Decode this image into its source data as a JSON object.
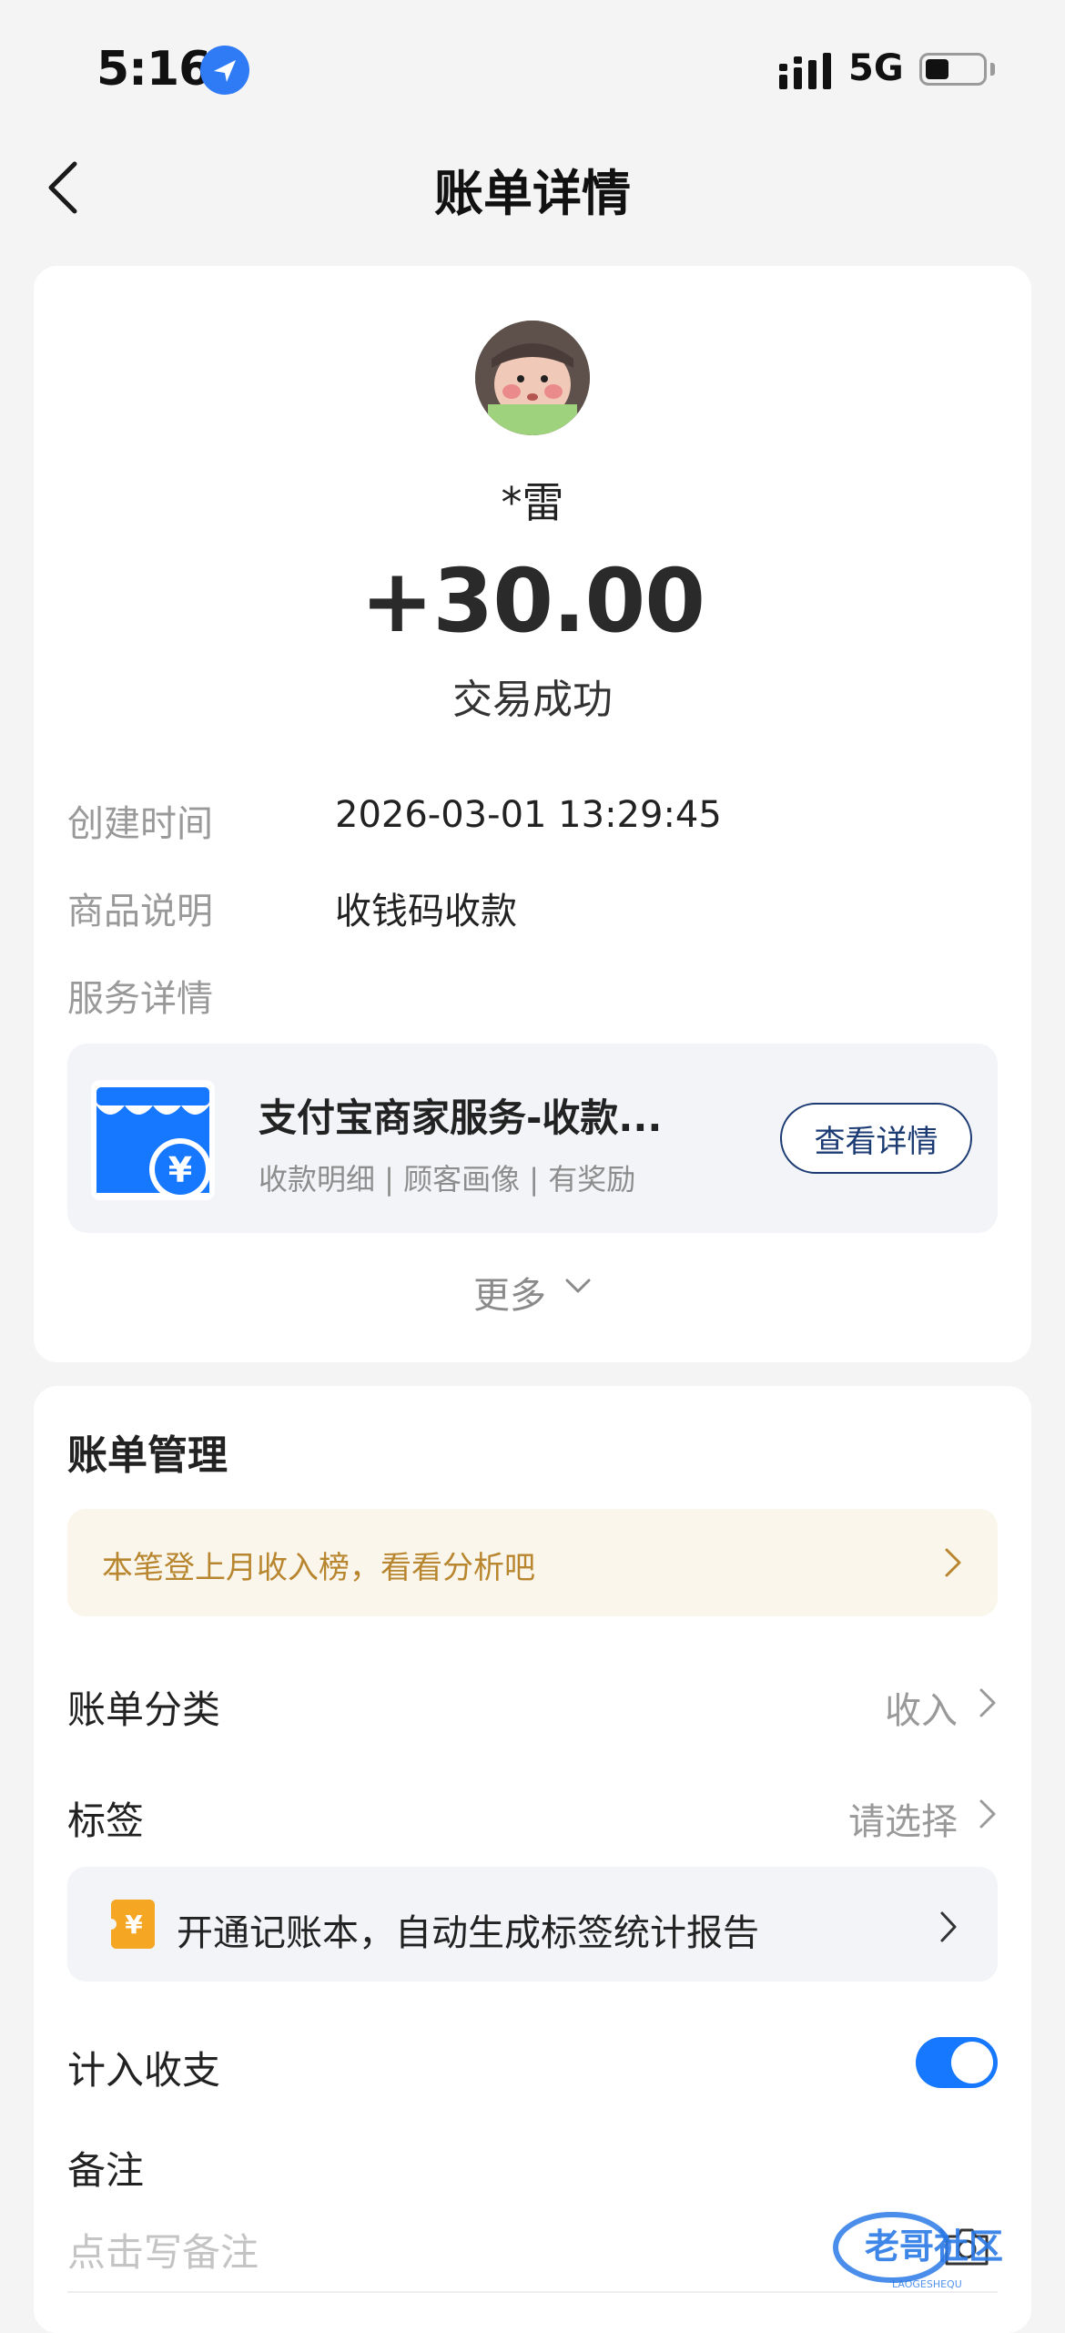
{
  "status_bar": {
    "time": "5:16",
    "network": "5G",
    "battery_level": 0.4
  },
  "nav": {
    "title": "账单详情"
  },
  "transaction": {
    "name": "*雷",
    "amount": "+30.00",
    "status": "交易成功"
  },
  "details": [
    {
      "label": "创建时间",
      "value": "2026-03-01 13:29:45"
    },
    {
      "label": "商品说明",
      "value": "收钱码收款"
    },
    {
      "label": "服务详情",
      "value": ""
    }
  ],
  "merchant_service": {
    "title": "支付宝商家服务-收款...",
    "subtitle": "收款明细 | 顾客画像 | 有奖励",
    "button": "查看详情",
    "icon_symbol": "¥"
  },
  "more_label": "更多",
  "management": {
    "title": "账单管理",
    "banner": "本笔登上月收入榜，看看分析吧",
    "category_label": "账单分类",
    "category_value": "收入",
    "tag_label": "标签",
    "tag_value": "请选择",
    "tag_promo": "开通记账本，自动生成标签统计报告",
    "coupon_symbol": "¥",
    "include_label": "计入收支",
    "include_enabled": true,
    "note_label": "备注",
    "note_placeholder": "点击写备注"
  },
  "watermark": {
    "text_cn": "老哥社区",
    "text_en": "LAOGESHEQU"
  },
  "colors": {
    "accent": "#1677ff",
    "banner_text": "#b8862f",
    "button_border": "#1c3b73"
  }
}
